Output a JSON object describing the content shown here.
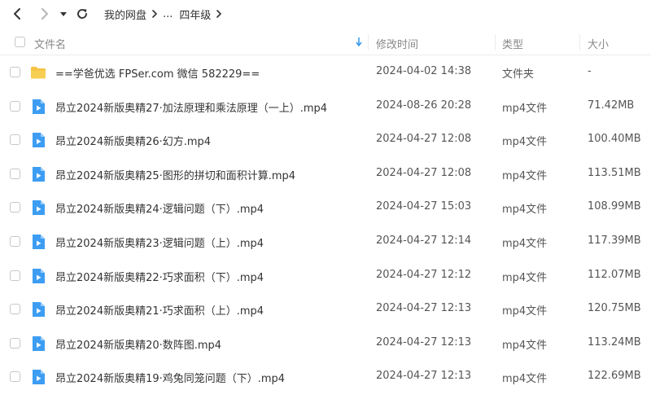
{
  "nav": {
    "breadcrumb": [
      "我的网盘",
      "...",
      "四年级"
    ]
  },
  "columns": {
    "name": "文件名",
    "time": "修改时间",
    "type": "类型",
    "size": "大小"
  },
  "colors": {
    "accent": "#3a9cf0",
    "folder": "#f5c242",
    "video": "#3d9df3"
  },
  "files": [
    {
      "name": "==学爸优选 FPSer.com 微信 582229==",
      "time": "2024-04-02 14:38",
      "type": "文件夹",
      "size": "-",
      "icon": "folder-icon"
    },
    {
      "name": "昂立2024新版奥精27·加法原理和乘法原理（一上）.mp4",
      "time": "2024-08-26 20:28",
      "type": "mp4文件",
      "size": "71.42MB",
      "icon": "video-file-icon"
    },
    {
      "name": "昂立2024新版奥精26·幻方.mp4",
      "time": "2024-04-27 12:08",
      "type": "mp4文件",
      "size": "100.40MB",
      "icon": "video-file-icon"
    },
    {
      "name": "昂立2024新版奥精25·图形的拼切和面积计算.mp4",
      "time": "2024-04-27 12:08",
      "type": "mp4文件",
      "size": "113.51MB",
      "icon": "video-file-icon"
    },
    {
      "name": "昂立2024新版奥精24·逻辑问题（下）.mp4",
      "time": "2024-04-27 15:03",
      "type": "mp4文件",
      "size": "108.99MB",
      "icon": "video-file-icon"
    },
    {
      "name": "昂立2024新版奥精23·逻辑问题（上）.mp4",
      "time": "2024-04-27 12:14",
      "type": "mp4文件",
      "size": "117.39MB",
      "icon": "video-file-icon"
    },
    {
      "name": "昂立2024新版奥精22·巧求面积（下）.mp4",
      "time": "2024-04-27 12:12",
      "type": "mp4文件",
      "size": "112.07MB",
      "icon": "video-file-icon"
    },
    {
      "name": "昂立2024新版奥精21·巧求面积（上）.mp4",
      "time": "2024-04-27 12:13",
      "type": "mp4文件",
      "size": "120.75MB",
      "icon": "video-file-icon"
    },
    {
      "name": "昂立2024新版奥精20·数阵图.mp4",
      "time": "2024-04-27 12:13",
      "type": "mp4文件",
      "size": "113.24MB",
      "icon": "video-file-icon"
    },
    {
      "name": "昂立2024新版奥精19·鸡兔同笼问题（下）.mp4",
      "time": "2024-04-27 12:13",
      "type": "mp4文件",
      "size": "122.69MB",
      "icon": "video-file-icon"
    }
  ]
}
